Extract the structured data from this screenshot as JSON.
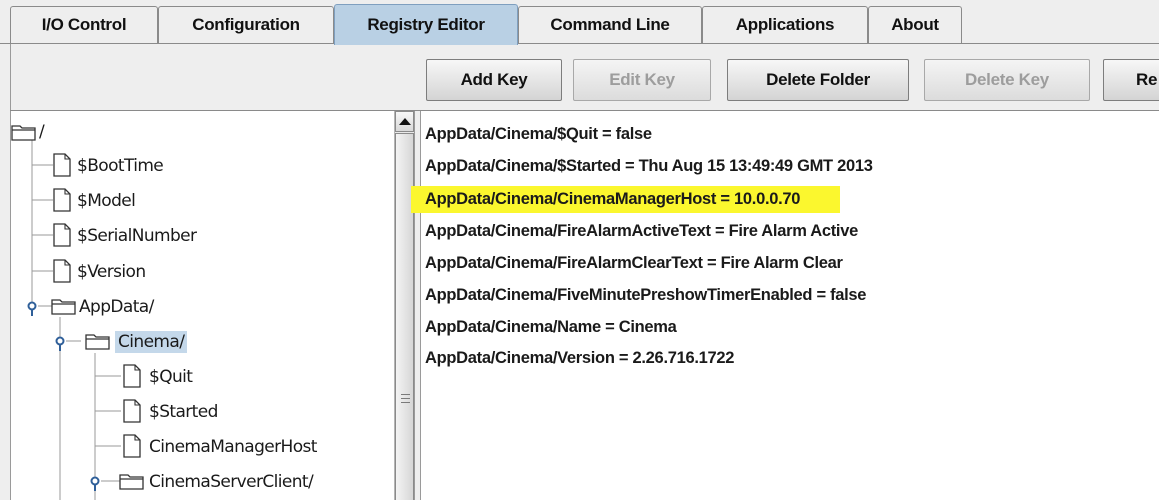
{
  "tabs": [
    {
      "label": "I/O Control",
      "active": false
    },
    {
      "label": "Configuration",
      "active": false
    },
    {
      "label": "Registry Editor",
      "active": true
    },
    {
      "label": "Command Line",
      "active": false
    },
    {
      "label": "Applications",
      "active": false
    },
    {
      "label": "About",
      "active": false
    }
  ],
  "toolbar": {
    "add_key": "Add Key",
    "edit_key": "Edit Key",
    "delete_folder": "Delete Folder",
    "delete_key": "Delete Key",
    "truncated": "Re"
  },
  "tree": {
    "root": "/",
    "boot_time": "$BootTime",
    "model": "$Model",
    "serial_number": "$SerialNumber",
    "version": "$Version",
    "app_data": "AppData/",
    "cinema": "Cinema/",
    "quit": "$Quit",
    "started": "$Started",
    "cinema_manager_host": "CinemaManagerHost",
    "cinema_server_client": "CinemaServerClient/"
  },
  "registry_values": [
    "AppData/Cinema/$Quit = false",
    "AppData/Cinema/$Started = Thu Aug 15 13:49:49 GMT 2013",
    "AppData/Cinema/CinemaManagerHost = 10.0.0.70",
    "AppData/Cinema/FireAlarmActiveText = Fire Alarm Active",
    "AppData/Cinema/FireAlarmClearText = Fire Alarm Clear",
    "AppData/Cinema/FiveMinutePreshowTimerEnabled = false",
    "AppData/Cinema/Name = Cinema",
    "AppData/Cinema/Version = 2.26.716.1722"
  ],
  "colors": {
    "active_tab": "#b9d0e4",
    "highlight": "#fbf72e",
    "selected_node": "#c4d8ea"
  }
}
